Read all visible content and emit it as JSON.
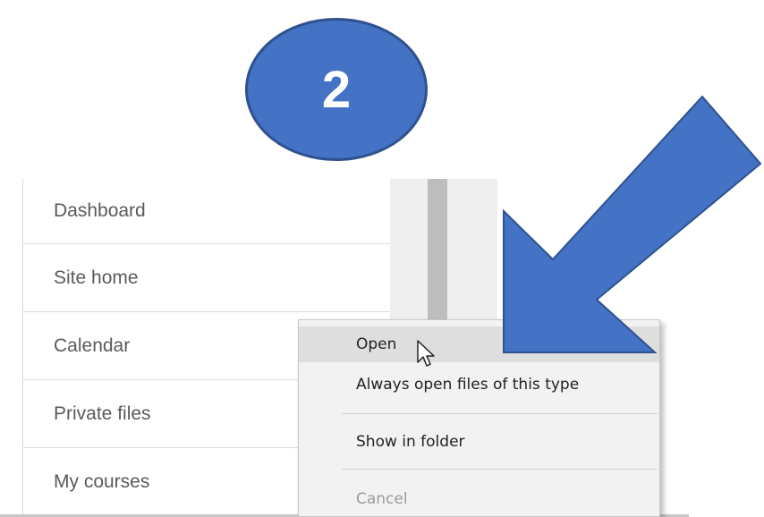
{
  "badge": {
    "step": "2"
  },
  "nav": {
    "items": [
      {
        "label": "Dashboard"
      },
      {
        "label": "Site home"
      },
      {
        "label": "Calendar"
      },
      {
        "label": "Private files"
      },
      {
        "label": "My courses"
      }
    ]
  },
  "context_menu": {
    "open_label": "Open",
    "always_open_label": "Always open files of this type",
    "show_in_folder_label": "Show in folder",
    "cancel_label": "Cancel"
  },
  "colors": {
    "badge_fill": "#4472c4",
    "badge_border": "#2f528f",
    "arrow_fill": "#4472c4"
  }
}
